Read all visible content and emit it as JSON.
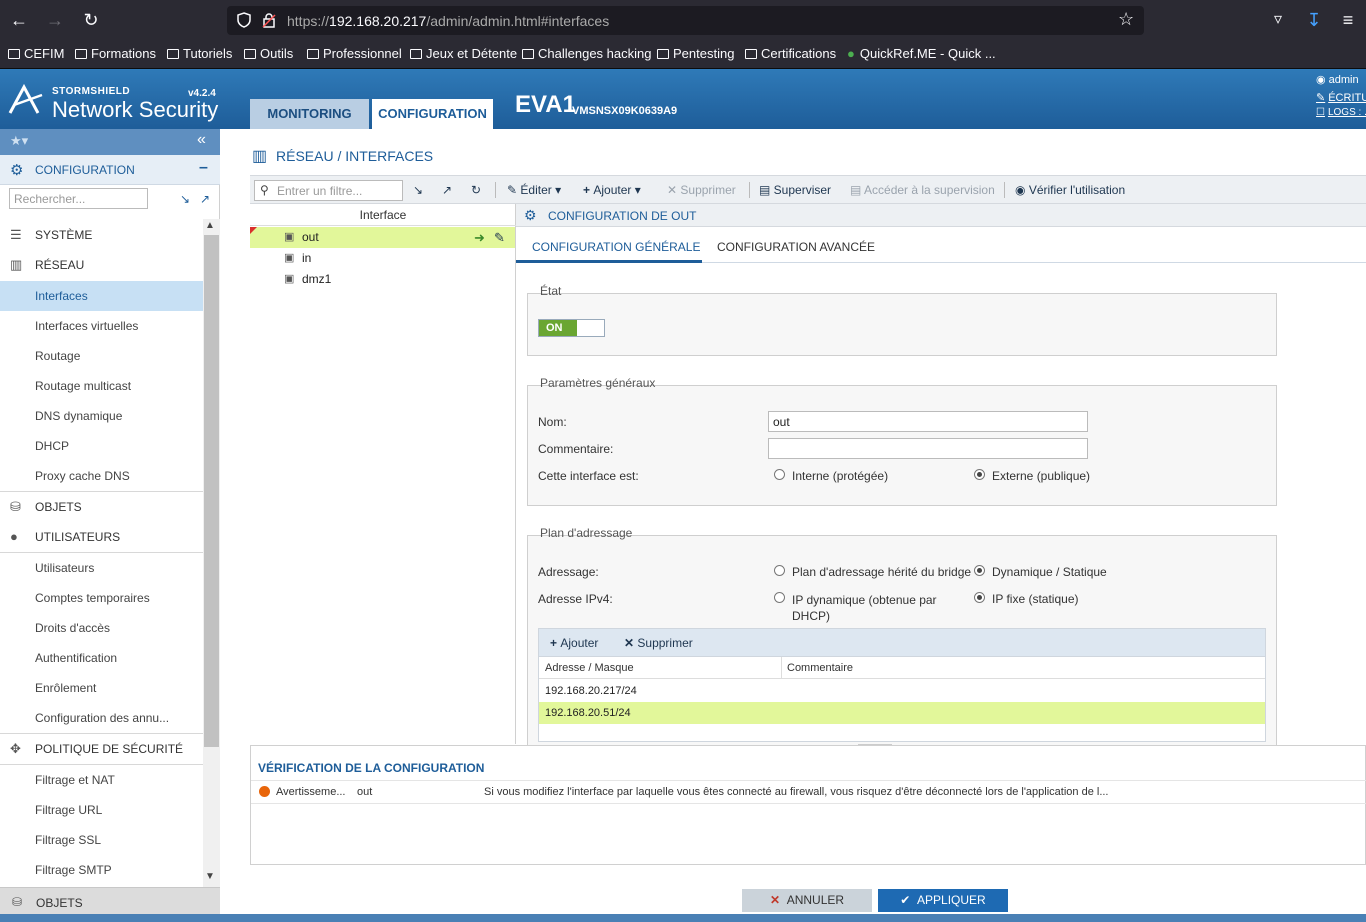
{
  "browser": {
    "url_scheme": "https://",
    "url_host": "192.168.20.217",
    "url_path": "/admin/admin.html#interfaces",
    "bookmarks": [
      "CEFIM",
      "Formations",
      "Tutoriels",
      "Outils",
      "Professionnel",
      "Jeux et Détente",
      "Challenges hacking",
      "Pentesting",
      "Certifications",
      "QuickRef.ME - Quick ..."
    ]
  },
  "header": {
    "brand_top": "STORMSHIELD",
    "brand_main": "Network Security",
    "version": "v4.2.4",
    "tabs": [
      "MONITORING",
      "CONFIGURATION"
    ],
    "firewall_name": "EVA1",
    "serial": "VMSNSX09K0639A9",
    "user": "admin",
    "write_label": "ÉCRITU",
    "logs_label": "LOGS : ..."
  },
  "sidebar": {
    "section_title": "CONFIGURATION",
    "search_placeholder": "Rechercher...",
    "items": [
      {
        "label": "SYSTÈME",
        "type": "section"
      },
      {
        "label": "RÉSEAU",
        "type": "section"
      },
      {
        "label": "Interfaces",
        "type": "item",
        "selected": true
      },
      {
        "label": "Interfaces virtuelles",
        "type": "item"
      },
      {
        "label": "Routage",
        "type": "item"
      },
      {
        "label": "Routage multicast",
        "type": "item"
      },
      {
        "label": "DNS dynamique",
        "type": "item"
      },
      {
        "label": "DHCP",
        "type": "item"
      },
      {
        "label": "Proxy cache DNS",
        "type": "item"
      },
      {
        "label": "OBJETS",
        "type": "section"
      },
      {
        "label": "UTILISATEURS",
        "type": "section"
      },
      {
        "label": "Utilisateurs",
        "type": "item"
      },
      {
        "label": "Comptes temporaires",
        "type": "item"
      },
      {
        "label": "Droits d'accès",
        "type": "item"
      },
      {
        "label": "Authentification",
        "type": "item"
      },
      {
        "label": "Enrôlement",
        "type": "item"
      },
      {
        "label": "Configuration des annu...",
        "type": "item"
      },
      {
        "label": "POLITIQUE DE SÉCURITÉ",
        "type": "section"
      },
      {
        "label": "Filtrage et NAT",
        "type": "item"
      },
      {
        "label": "Filtrage URL",
        "type": "item"
      },
      {
        "label": "Filtrage SSL",
        "type": "item"
      },
      {
        "label": "Filtrage SMTP",
        "type": "item"
      }
    ],
    "bottom_label": "OBJETS"
  },
  "breadcrumb": "RÉSEAU / INTERFACES",
  "toolbar": {
    "filter_placeholder": "Entrer un filtre...",
    "edit": "Éditer",
    "add": "Ajouter",
    "delete": "Supprimer",
    "supervise": "Superviser",
    "access_supervision": "Accéder à la supervision",
    "check_usage": "Vérifier l'utilisation"
  },
  "interfaces": {
    "column": "Interface",
    "rows": [
      "out",
      "in",
      "dmz1"
    ],
    "selected": "out"
  },
  "config": {
    "title": "CONFIGURATION DE OUT",
    "tabs": [
      "CONFIGURATION GÉNÉRALE",
      "CONFIGURATION AVANCÉE"
    ],
    "state_legend": "État",
    "state_value": "ON",
    "general_legend": "Paramètres généraux",
    "name_label": "Nom:",
    "name_value": "out",
    "comment_label": "Commentaire:",
    "comment_value": "",
    "iface_type_label": "Cette interface est:",
    "iface_internal": "Interne (protégée)",
    "iface_external": "Externe (publique)",
    "addr_legend": "Plan d'adressage",
    "addressing_label": "Adressage:",
    "addressing_bridge": "Plan d'adressage hérité du bridge",
    "addressing_dynamic": "Dynamique / Statique",
    "ipv4_label": "Adresse IPv4:",
    "ipv4_dhcp": "IP dynamique (obtenue par DHCP)",
    "ipv4_static": "IP fixe (statique)",
    "grid_add": "Ajouter",
    "grid_delete": "Supprimer",
    "grid_col_addr": "Adresse / Masque",
    "grid_col_comment": "Commentaire",
    "addresses": [
      "192.168.20.217/24",
      "192.168.20.51/24"
    ]
  },
  "verification": {
    "title": "VÉRIFICATION DE LA CONFIGURATION",
    "level": "Avertisseme...",
    "object": "out",
    "message": "Si vous modifiez l'interface par laquelle vous êtes connecté au firewall, vous risquez d'être déconnecté lors de l'application de l..."
  },
  "actions": {
    "cancel": "ANNULER",
    "apply": "APPLIQUER"
  },
  "colors": {
    "brand_blue": "#1e5d99",
    "header_gradient": "#2f7ab8",
    "selection_green": "#e2f79a",
    "toggle_on": "#6aa632",
    "warning": "#e8650a"
  }
}
